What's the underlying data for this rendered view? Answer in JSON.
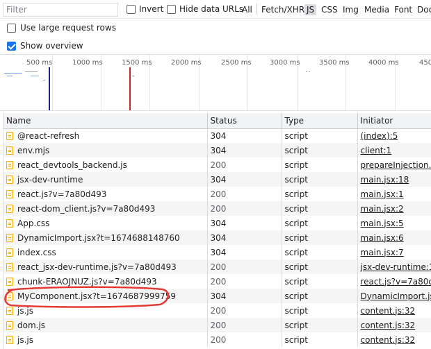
{
  "filterbar": {
    "filter_placeholder": "Filter",
    "invert_label": "Invert",
    "hide_data_urls_label": "Hide data URLs",
    "types": [
      "All",
      "Fetch/XHR",
      "JS",
      "CSS",
      "Img",
      "Media",
      "Font",
      "Doc"
    ],
    "active_type": "JS"
  },
  "options": {
    "large_rows_label": "Use large request rows",
    "large_rows_checked": false,
    "show_overview_label": "Show overview",
    "show_overview_checked": true
  },
  "overview": {
    "ticks": [
      "500 ms",
      "1000 ms",
      "1500 ms",
      "2000 ms",
      "2500 ms",
      "3000 ms",
      "3500 ms",
      "4000 ms",
      "450"
    ],
    "blue_marker_color": "#1a237e",
    "red_marker_color": "#c62828"
  },
  "table": {
    "headers": {
      "name": "Name",
      "status": "Status",
      "type": "Type",
      "initiator": "Initiator"
    },
    "rows": [
      {
        "name": "@react-refresh",
        "status": "304",
        "type": "script",
        "initiator": "(index):5"
      },
      {
        "name": "env.mjs",
        "status": "304",
        "type": "script",
        "initiator": "client:1"
      },
      {
        "name": "react_devtools_backend.js",
        "status": "200",
        "type": "script",
        "initiator": "prepareInjection.js:"
      },
      {
        "name": "jsx-dev-runtime",
        "status": "304",
        "type": "script",
        "initiator": "main.jsx:18"
      },
      {
        "name": "react.js?v=7a80d493",
        "status": "200",
        "type": "script",
        "initiator": "main.jsx:1"
      },
      {
        "name": "react-dom_client.js?v=7a80d493",
        "status": "200",
        "type": "script",
        "initiator": "main.jsx:2"
      },
      {
        "name": "App.css",
        "status": "304",
        "type": "script",
        "initiator": "main.jsx:5"
      },
      {
        "name": "DynamicImport.jsx?t=1674688148760",
        "status": "304",
        "type": "script",
        "initiator": "main.jsx:6"
      },
      {
        "name": "index.css",
        "status": "304",
        "type": "script",
        "initiator": "main.jsx:7"
      },
      {
        "name": "react_jsx-dev-runtime.js?v=7a80d493",
        "status": "200",
        "type": "script",
        "initiator": "jsx-dev-runtime:1"
      },
      {
        "name": "chunk-ERAOJNUZ.js?v=7a80d493",
        "status": "200",
        "type": "script",
        "initiator": "react.js?v=7a80d4"
      },
      {
        "name": "MyComponent.jsx?t=1674687999759",
        "status": "304",
        "type": "script",
        "initiator": "DynamicImport.jsx:"
      },
      {
        "name": "js.js",
        "status": "200",
        "type": "script",
        "initiator": "content.js:32"
      },
      {
        "name": "dom.js",
        "status": "200",
        "type": "script",
        "initiator": "content.js:32"
      },
      {
        "name": "js.js",
        "status": "200",
        "type": "script",
        "initiator": "content.js:32"
      }
    ]
  },
  "annotation": {
    "color": "#e53935",
    "highlighted_row": "MyComponent.jsx?t=1674687999759"
  }
}
